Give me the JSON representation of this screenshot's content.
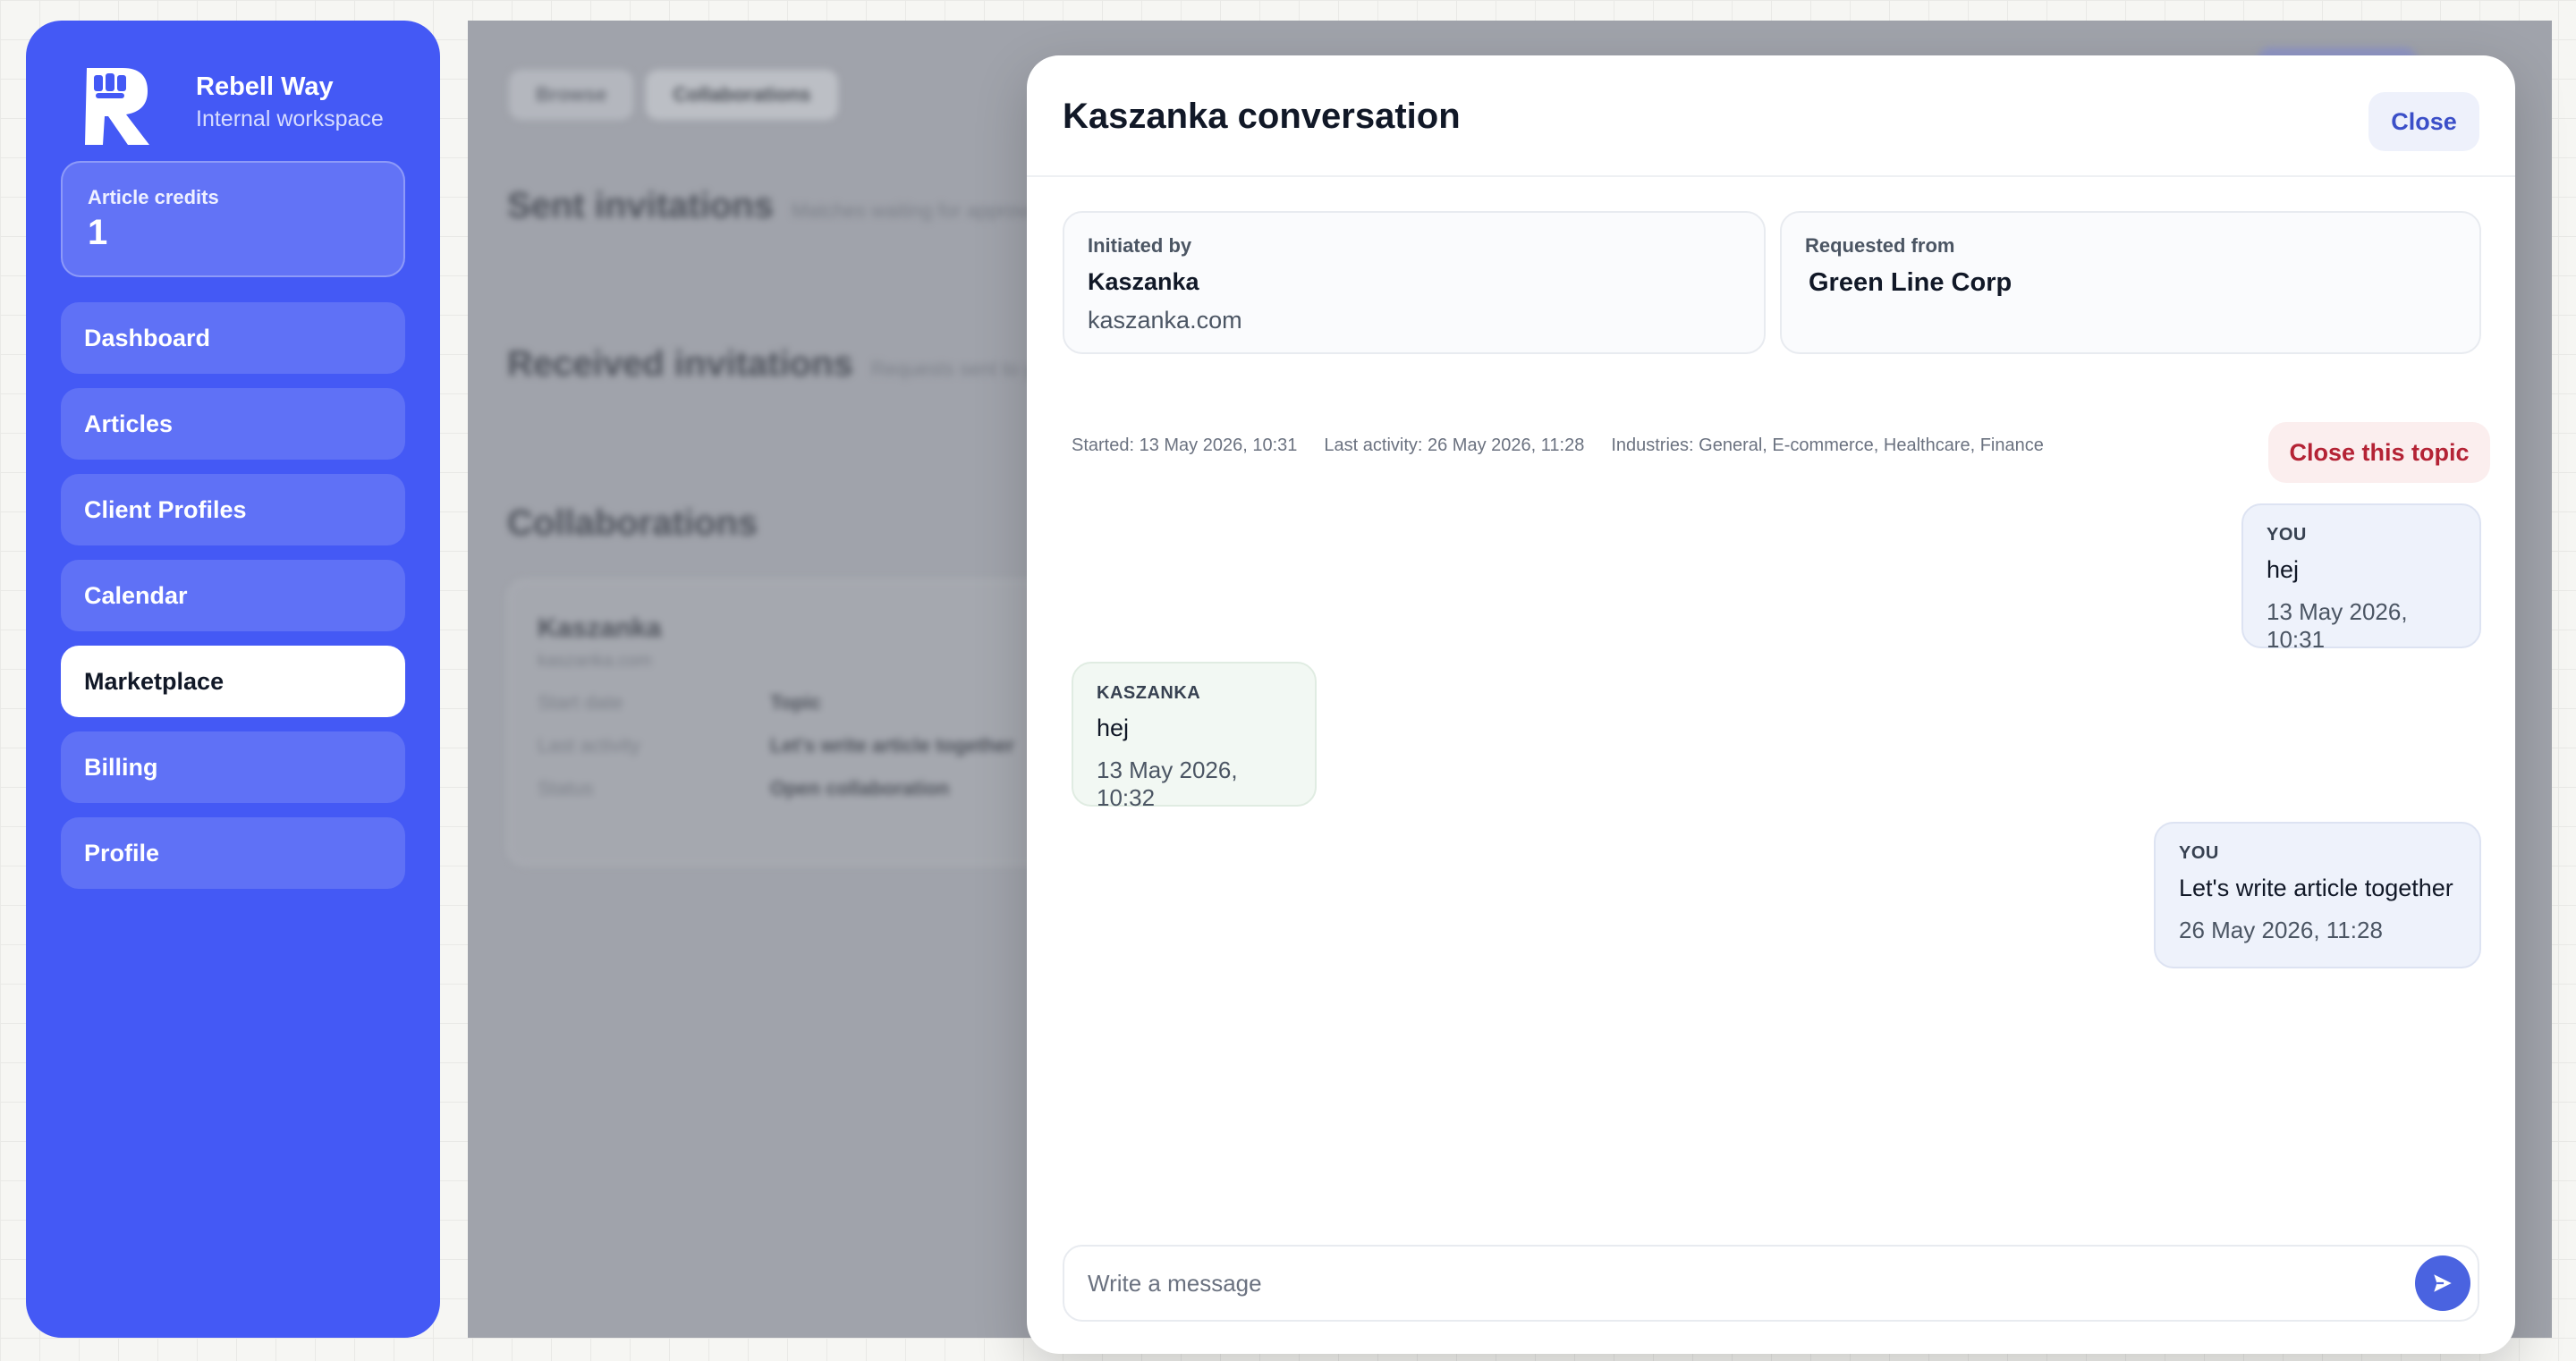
{
  "sidebar": {
    "brand_name": "Rebell Way",
    "brand_subtitle": "Internal workspace",
    "credits_label": "Article credits",
    "credits_value": "1",
    "nav": [
      {
        "label": "Dashboard",
        "active": false
      },
      {
        "label": "Articles",
        "active": false
      },
      {
        "label": "Client Profiles",
        "active": false
      },
      {
        "label": "Calendar",
        "active": false
      },
      {
        "label": "Marketplace",
        "active": true
      },
      {
        "label": "Billing",
        "active": false
      },
      {
        "label": "Profile",
        "active": false
      }
    ]
  },
  "background": {
    "tabs": [
      "Browse",
      "Collaborations"
    ],
    "sent_title": "Sent invitations",
    "sent_subtitle": "Matches waiting for approval",
    "received_title": "Received invitations",
    "received_subtitle": "Requests sent to you",
    "collab_title": "Collaborations",
    "card_title": "Kaszanka",
    "card_subtitle": "kaszanka.com",
    "card_rows": [
      {
        "k": "Start date",
        "v": "Topic"
      },
      {
        "k": "Last activity",
        "v": "Let's write article together"
      },
      {
        "k": "Status",
        "v": "Open collaboration"
      }
    ]
  },
  "modal": {
    "title": "Kaszanka conversation",
    "close_label": "Close",
    "initiated_label": "Initiated by",
    "initiated_name": "Kaszanka",
    "initiated_domain": "kaszanka.com",
    "requested_label": "Requested from",
    "requested_name": "Green Line Corp",
    "meta": {
      "started": "Started: 13 May 2026, 10:31",
      "last_activity": "Last activity: 26 May 2026, 11:28",
      "industries": "Industries: General, E-commerce, Healthcare, Finance"
    },
    "close_topic_label": "Close this topic",
    "messages": [
      {
        "author": "YOU",
        "text": "hej",
        "time": "13 May 2026, 10:31",
        "mine": true
      },
      {
        "author": "KASZANKA",
        "text": "hej",
        "time": "13 May 2026, 10:32",
        "mine": false
      },
      {
        "author": "YOU",
        "text": "Let's write article together",
        "time": "26 May 2026, 11:28",
        "mine": true
      }
    ],
    "composer_placeholder": "Write a message"
  },
  "colors": {
    "sidebar": "#4459f5",
    "accent": "#4a63e0",
    "danger": "#b42335"
  },
  "icons": {
    "brand": "fist-logo-icon",
    "send": "send-arrow-icon"
  }
}
